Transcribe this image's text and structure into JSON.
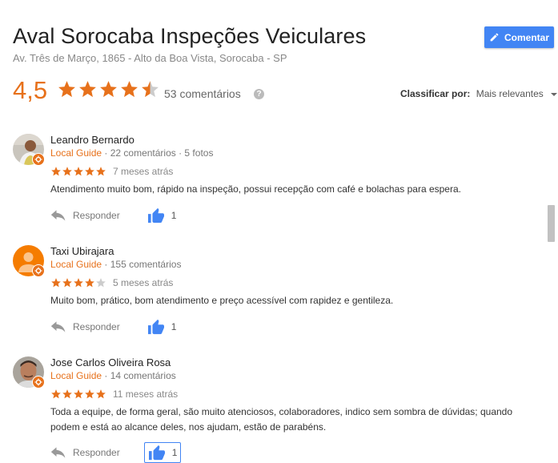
{
  "business": {
    "name": "Aval Sorocaba Inspeções Veiculares",
    "address": "Av. Três de Março, 1865 - Alto da Boa Vista, Sorocaba - SP"
  },
  "comment_button": {
    "label": "Comentar",
    "icon": "pencil-icon"
  },
  "summary": {
    "rating": "4,5",
    "rating_value": 4.5,
    "review_count": "53 comentários",
    "sort_label": "Classificar por:",
    "sort_value": "Mais relevantes"
  },
  "colors": {
    "accent": "#e7711b",
    "button": "#4285f4",
    "star_empty": "#cccccc",
    "thumb": "#4285f4"
  },
  "reviews": [
    {
      "name": "Leandro Bernardo",
      "local_guide": "Local Guide",
      "stats": "· 22 comentários · 5 fotos",
      "stars": 5,
      "date": "7 meses atrás",
      "text": "Atendimento muito bom, rápido na inspeção, possui recepção com café e bolachas para espera.",
      "reply_label": "Responder",
      "likes": "1"
    },
    {
      "name": "Taxi Ubirajara",
      "local_guide": "Local Guide",
      "stats": "· 155 comentários",
      "stars": 4,
      "date": "5 meses atrás",
      "text": "Muito bom, prático, bom atendimento e preço acessível com rapidez e gentileza.",
      "reply_label": "Responder",
      "likes": "1"
    },
    {
      "name": "Jose Carlos Oliveira Rosa",
      "local_guide": "Local Guide",
      "stats": "· 14 comentários",
      "stars": 5,
      "date": "11 meses atrás",
      "text": "Toda a equipe, de forma geral, são muito atenciosos, colaboradores, indico sem sombra de dúvidas; quando podem e está ao alcance deles, nos ajudam, estão de parabéns.",
      "reply_label": "Responder",
      "likes": "1"
    }
  ]
}
